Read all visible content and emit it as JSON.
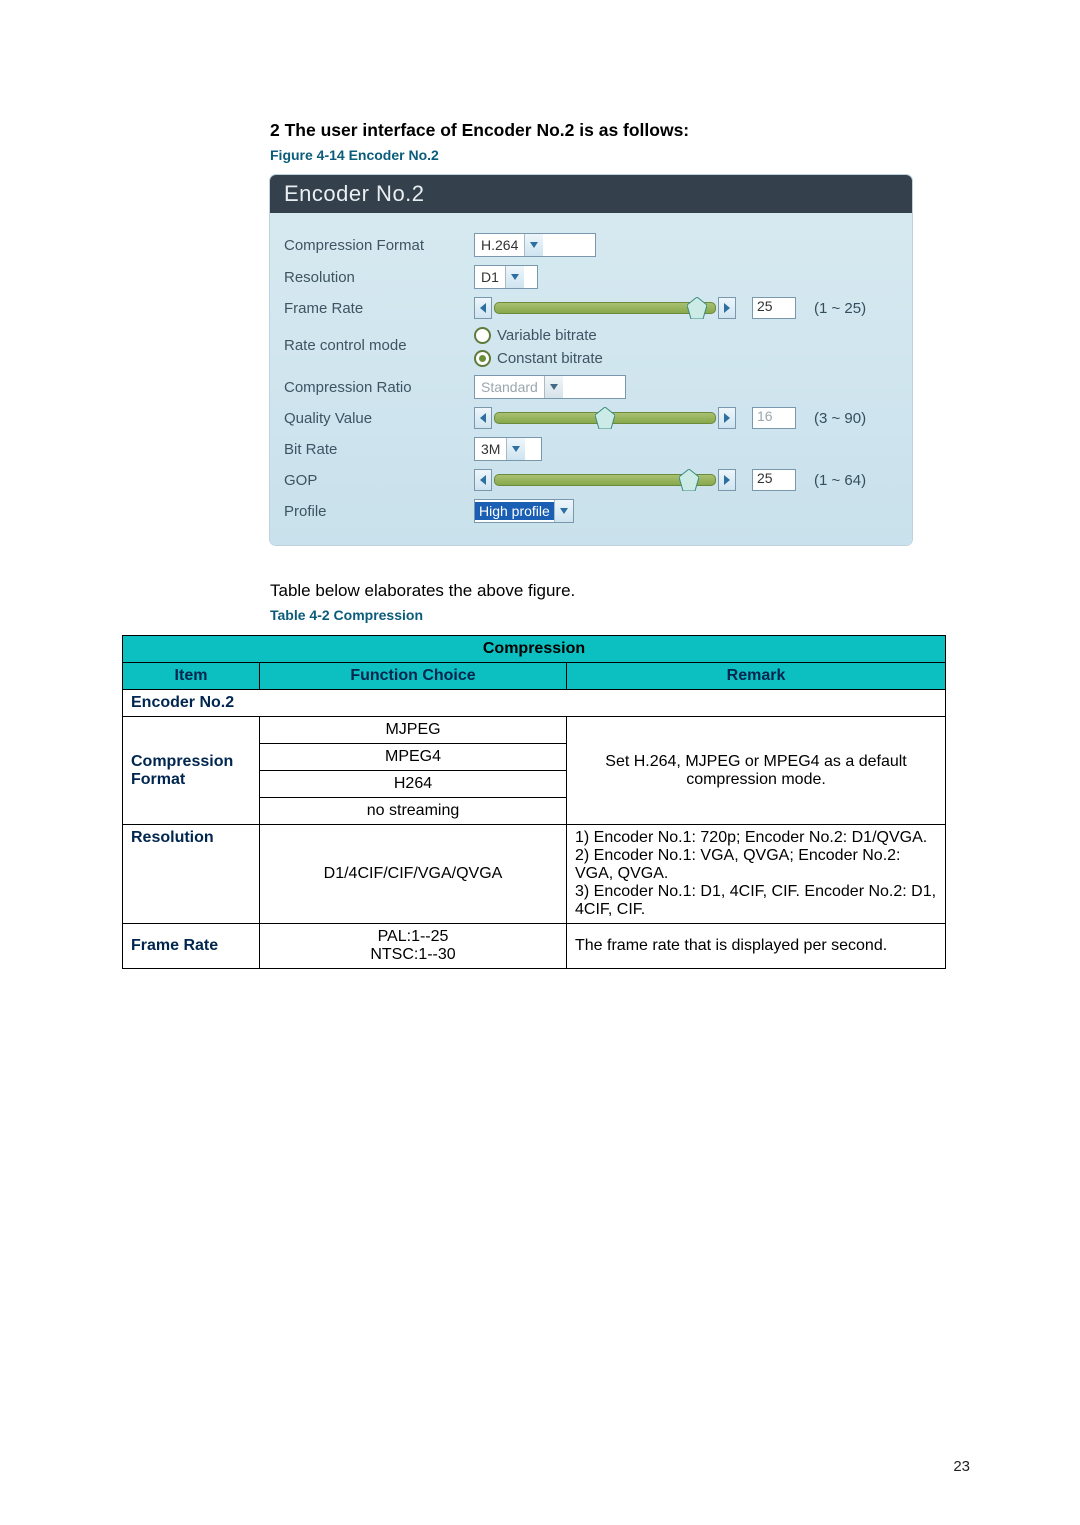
{
  "heading": "2 The user interface of Encoder No.2 is as follows:",
  "figure_caption": "Figure 4-14 Encoder No.2",
  "panel": {
    "title": "Encoder No.2",
    "rows": {
      "compression_format": {
        "label": "Compression Format",
        "value": "H.264"
      },
      "resolution": {
        "label": "Resolution",
        "value": "D1"
      },
      "frame_rate": {
        "label": "Frame Rate",
        "value": "25",
        "range": "(1 ~ 25)"
      },
      "rate_control": {
        "label": "Rate control mode",
        "options": {
          "variable": "Variable bitrate",
          "constant": "Constant bitrate"
        },
        "selected": "constant"
      },
      "compression_ratio": {
        "label": "Compression Ratio",
        "value": "Standard"
      },
      "quality_value": {
        "label": "Quality Value",
        "value": "16",
        "range": "(3 ~ 90)"
      },
      "bit_rate": {
        "label": "Bit Rate",
        "value": "3M"
      },
      "gop": {
        "label": "GOP",
        "value": "25",
        "range": "(1 ~ 64)"
      },
      "profile": {
        "label": "Profile",
        "value": "High profile"
      }
    }
  },
  "paragraph": "Table below elaborates the above figure.",
  "table_caption": "Table 4-2 Compression",
  "table": {
    "title": "Compression",
    "head": {
      "item": "Item",
      "func": "Function Choice",
      "remark": "Remark"
    },
    "section": "Encoder No.2",
    "rows": {
      "cf": {
        "item": "Compression Format",
        "choices": [
          "MJPEG",
          "MPEG4",
          "H264",
          "no streaming"
        ],
        "remark": "Set H.264, MJPEG or MPEG4 as a default compression mode."
      },
      "res": {
        "item": "Resolution",
        "choice": "D1/4CIF/CIF/VGA/QVGA",
        "remark": "1) Encoder No.1: 720p; Encoder No.2: D1/QVGA.\n2) Encoder No.1: VGA, QVGA; Encoder No.2: VGA, QVGA.\n3) Encoder No.1: D1, 4CIF, CIF. Encoder No.2: D1, 4CIF, CIF."
      },
      "fr": {
        "item": "Frame Rate",
        "choice": "PAL:1--25\nNTSC:1--30",
        "remark": "The frame rate that is displayed per second."
      }
    }
  },
  "page_number": "23"
}
